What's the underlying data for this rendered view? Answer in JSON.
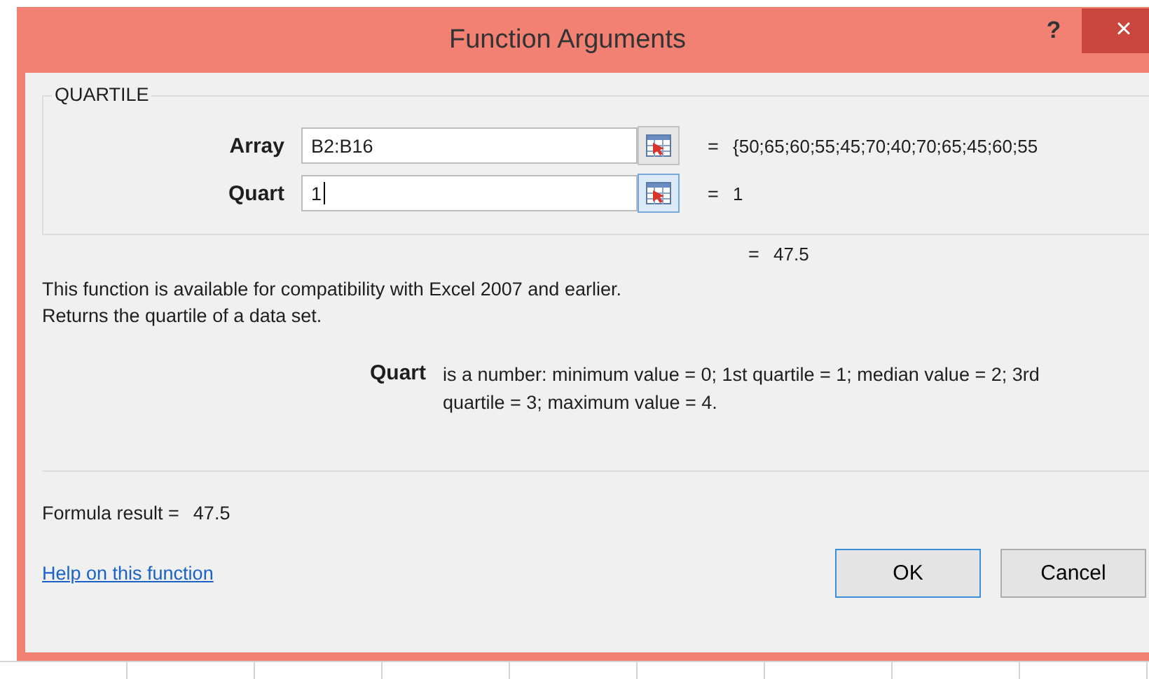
{
  "window": {
    "title": "Function Arguments",
    "help_button": "?",
    "close_button": "×"
  },
  "function_name": "QUARTILE",
  "arguments": [
    {
      "label": "Array",
      "value": "B2:B16",
      "equals": "=",
      "result": "{50;65;60;55;45;70;40;70;65;45;60;55",
      "focused": false
    },
    {
      "label": "Quart",
      "value": "1",
      "equals": "=",
      "result": "1",
      "focused": true
    }
  ],
  "result_line": {
    "equals": "=",
    "value": "47.5"
  },
  "description": [
    "This function is available for compatibility with Excel 2007 and earlier.",
    "Returns the quartile of a data set."
  ],
  "argument_help": {
    "label": "Quart",
    "text": "is a number: minimum value = 0; 1st quartile = 1; median value = 2; 3rd quartile = 3; maximum value = 4."
  },
  "formula_result": {
    "label": "Formula result =",
    "value": "47.5"
  },
  "help_link": "Help on this function",
  "buttons": [
    {
      "label": "OK",
      "default": true
    },
    {
      "label": "Cancel",
      "default": false
    }
  ]
}
